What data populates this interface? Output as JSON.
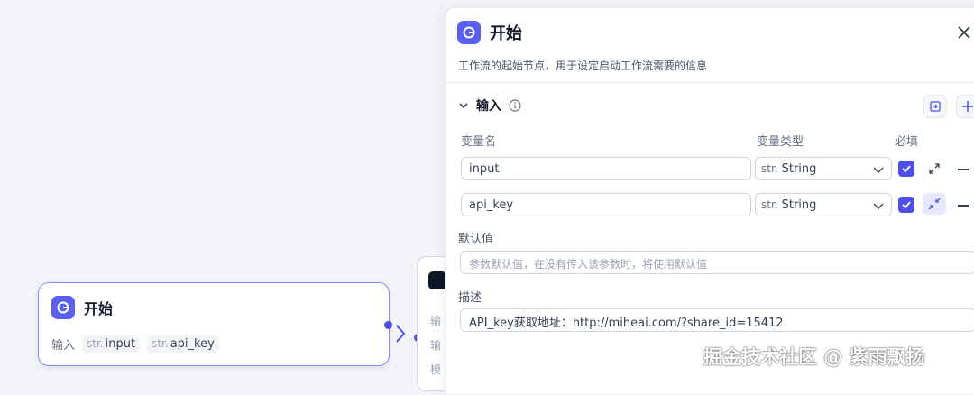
{
  "canvas": {
    "start_node": {
      "title": "开始",
      "inputs_label": "输入",
      "vars": [
        {
          "type": "str.",
          "name": "input"
        },
        {
          "type": "str.",
          "name": "api_key"
        }
      ]
    },
    "next_node": {
      "labels": [
        "输",
        "输",
        "模"
      ]
    }
  },
  "panel": {
    "title": "开始",
    "description": "工作流的起始节点，用于设定启动工作流需要的信息",
    "section_title": "输入",
    "columns": {
      "name": "变量名",
      "type": "变量类型",
      "required": "必填"
    },
    "variables": [
      {
        "name": "input",
        "type_prefix": "str.",
        "type": "String",
        "required": true
      },
      {
        "name": "api_key",
        "type_prefix": "str.",
        "type": "String",
        "required": true
      }
    ],
    "default_label": "默认值",
    "default_placeholder": "参数默认值，在没有传入该参数时，将使用默认值",
    "desc_label": "描述",
    "desc_value": "API_key获取地址：http://miheai.com/?share_id=15412"
  },
  "watermark": "掘金技术社区 @ 紫雨飘扬",
  "colors": {
    "accent": "#4f4fe8",
    "node_border": "#8a8cf4"
  }
}
